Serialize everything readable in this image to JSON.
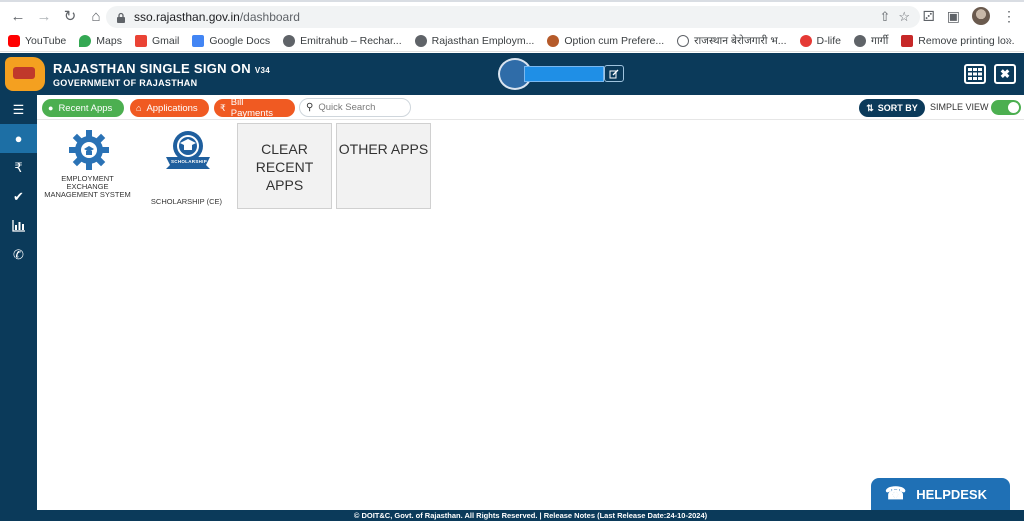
{
  "browser": {
    "url_host": "sso.rajasthan.gov.in",
    "url_path": "/dashboard"
  },
  "bookmarks": [
    {
      "label": "YouTube",
      "color": "#ff0000"
    },
    {
      "label": "Maps",
      "color": "#34a853"
    },
    {
      "label": "Gmail",
      "color": "#ea4335"
    },
    {
      "label": "Google Docs",
      "color": "#4285f4"
    },
    {
      "label": "Emitrahub – Rechar...",
      "color": "#5f6368"
    },
    {
      "label": "Rajasthan Employm...",
      "color": "#5f6368"
    },
    {
      "label": "Option cum Prefere...",
      "color": "#b55a2a"
    },
    {
      "label": "राजस्थान बेरोजगारी भ...",
      "color": "#5f6368"
    },
    {
      "label": "D-life",
      "color": "#e53935"
    },
    {
      "label": "गार्गी",
      "color": "#5f6368"
    },
    {
      "label": "Remove printing lo...",
      "color": "#c62828"
    }
  ],
  "header": {
    "title": "RAJASTHAN SINGLE SIGN ON",
    "version": "V34",
    "subtitle": "GOVERNMENT OF RAJASTHAN"
  },
  "toolbar": {
    "recent_apps": "Recent Apps",
    "applications": "Applications",
    "bill_payments": "Bill Payments",
    "search_placeholder": "Quick Search",
    "sort_by": "SORT BY",
    "simple_view": "SIMPLE VIEW"
  },
  "tiles": [
    {
      "label": "EMPLOYMENT EXCHANGE MANAGEMENT SYSTEM"
    },
    {
      "label": "SCHOLARSHIP (CE)",
      "icon_text": "SCHOLARSHIP"
    },
    {
      "label": "CLEAR RECENT APPS"
    },
    {
      "label": "OTHER APPS"
    }
  ],
  "footer": {
    "text": "© DOIT&C, Govt. of Rajasthan. All Rights Reserved.  |  Release Notes (Last Release Date:24-10-2024)"
  },
  "helpdesk": {
    "label": "HELPDESK"
  },
  "colors": {
    "header_bg": "#0b3a5a",
    "green": "#4caf50",
    "orange": "#f05a22",
    "helpdesk": "#1f70b5"
  }
}
